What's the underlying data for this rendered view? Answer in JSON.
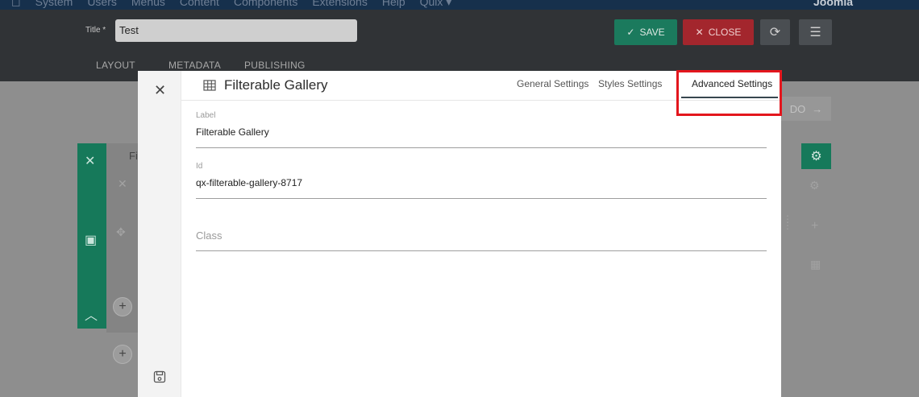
{
  "topnav": {
    "items": [
      "System",
      "Users",
      "Menus",
      "Content",
      "Components",
      "Extensions",
      "Help",
      "Quix ▾"
    ],
    "brand": "Joomla"
  },
  "editor": {
    "title_label": "Title *",
    "title_value": "Test",
    "save_label": "SAVE",
    "close_label": "CLOSE",
    "tabs": [
      "LAYOUT",
      "METADATA",
      "PUBLISHING"
    ]
  },
  "background": {
    "prev_label": "DO",
    "partial_text": "Fi"
  },
  "modal": {
    "title": "Filterable Gallery",
    "tabs": {
      "general": "General Settings",
      "styles": "Styles Settings",
      "advanced": "Advanced Settings"
    },
    "fields": {
      "label": {
        "label": "Label",
        "value": "Filterable Gallery"
      },
      "id": {
        "label": "Id",
        "value": "qx-filterable-gallery-8717"
      },
      "class": {
        "placeholder": "Class"
      }
    }
  },
  "colors": {
    "save": "#1b7a5d",
    "close": "#a3262d",
    "highlight": "#e3161d",
    "builder_green": "#16795a"
  }
}
